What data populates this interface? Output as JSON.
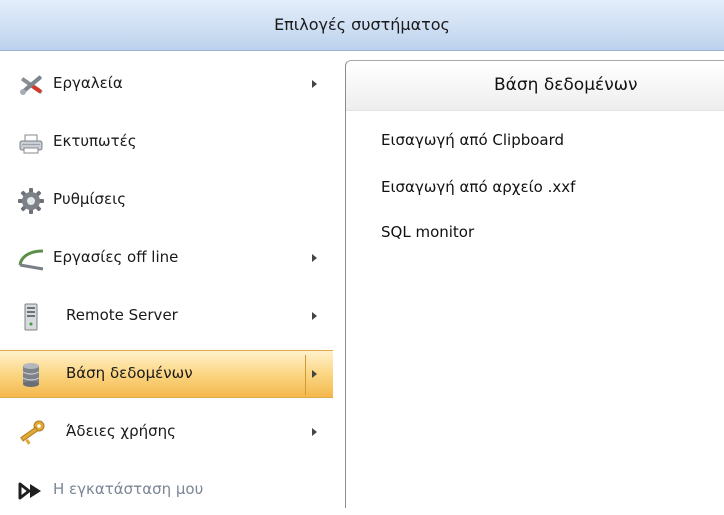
{
  "window": {
    "title": "Επιλογές συστήματος"
  },
  "menu": {
    "items": [
      {
        "label": "Εργαλεία",
        "icon": "tools-icon",
        "has_submenu": true
      },
      {
        "label": "Εκτυπωτές",
        "icon": "printer-icon",
        "has_submenu": false
      },
      {
        "label": "Ρυθμίσεις",
        "icon": "gear-icon",
        "has_submenu": false
      },
      {
        "label": "Εργασίες off line",
        "icon": "cable-icon",
        "has_submenu": true
      },
      {
        "label": "Remote Server",
        "icon": "server-icon",
        "has_submenu": true
      },
      {
        "label": "Βάση δεδομένων",
        "icon": "database-icon",
        "has_submenu": true,
        "selected": true
      },
      {
        "label": "Άδειες χρήσης",
        "icon": "key-icon",
        "has_submenu": true
      },
      {
        "label": "Η εγκατάσταση μου",
        "icon": "installation-icon",
        "has_submenu": false
      }
    ]
  },
  "submenu": {
    "title": "Βάση δεδομένων",
    "items": [
      {
        "label": "Εισαγωγή από Clipboard"
      },
      {
        "label": "Εισαγωγή από αρχείο .xxf"
      },
      {
        "label": "SQL monitor"
      }
    ]
  },
  "colors": {
    "title_bar": "#cfdff3",
    "selected_item": "#fbd683",
    "disabled_text": "#7b8694"
  }
}
